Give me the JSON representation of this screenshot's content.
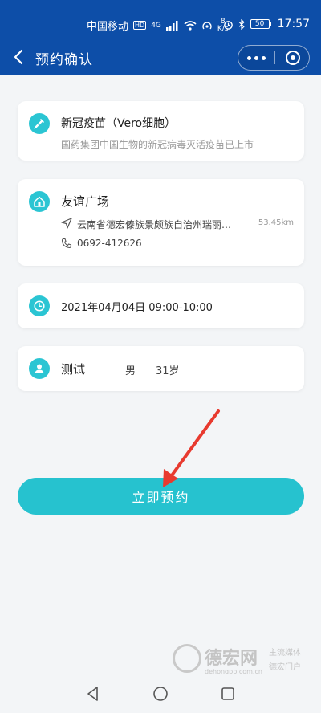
{
  "status_bar": {
    "carrier": "中国移动",
    "hd": "HD",
    "network": "4G",
    "speed_value": "8",
    "speed_unit": "K/s",
    "battery": "50",
    "time": "17:57"
  },
  "nav": {
    "title": "预约确认"
  },
  "vaccine": {
    "name": "新冠疫苗（Vero细胞）",
    "desc": "国药集团中国生物的新冠病毒灭活疫苗已上市",
    "icon": "syringe-icon"
  },
  "site": {
    "name": "友谊广场",
    "address": "云南省德宏傣族景颇族自治州瑞丽…",
    "distance": "53.45km",
    "phone": "0692-412626",
    "icon": "home-icon"
  },
  "time_slot": {
    "text": "2021年04月04日 09:00-10:00",
    "icon": "clock-icon"
  },
  "person": {
    "name": "测试",
    "gender": "男",
    "age": "31岁",
    "icon": "user-icon"
  },
  "actions": {
    "book_label": "立即预约"
  },
  "watermark": {
    "name": "德宏网",
    "url": "dehongpp.com.cn",
    "tag1": "主流媒体",
    "tag2": "德宏门户"
  },
  "colors": {
    "brand_bar": "#0d4ea8",
    "accent": "#26c2cf",
    "annotation": "#e83a2f"
  }
}
